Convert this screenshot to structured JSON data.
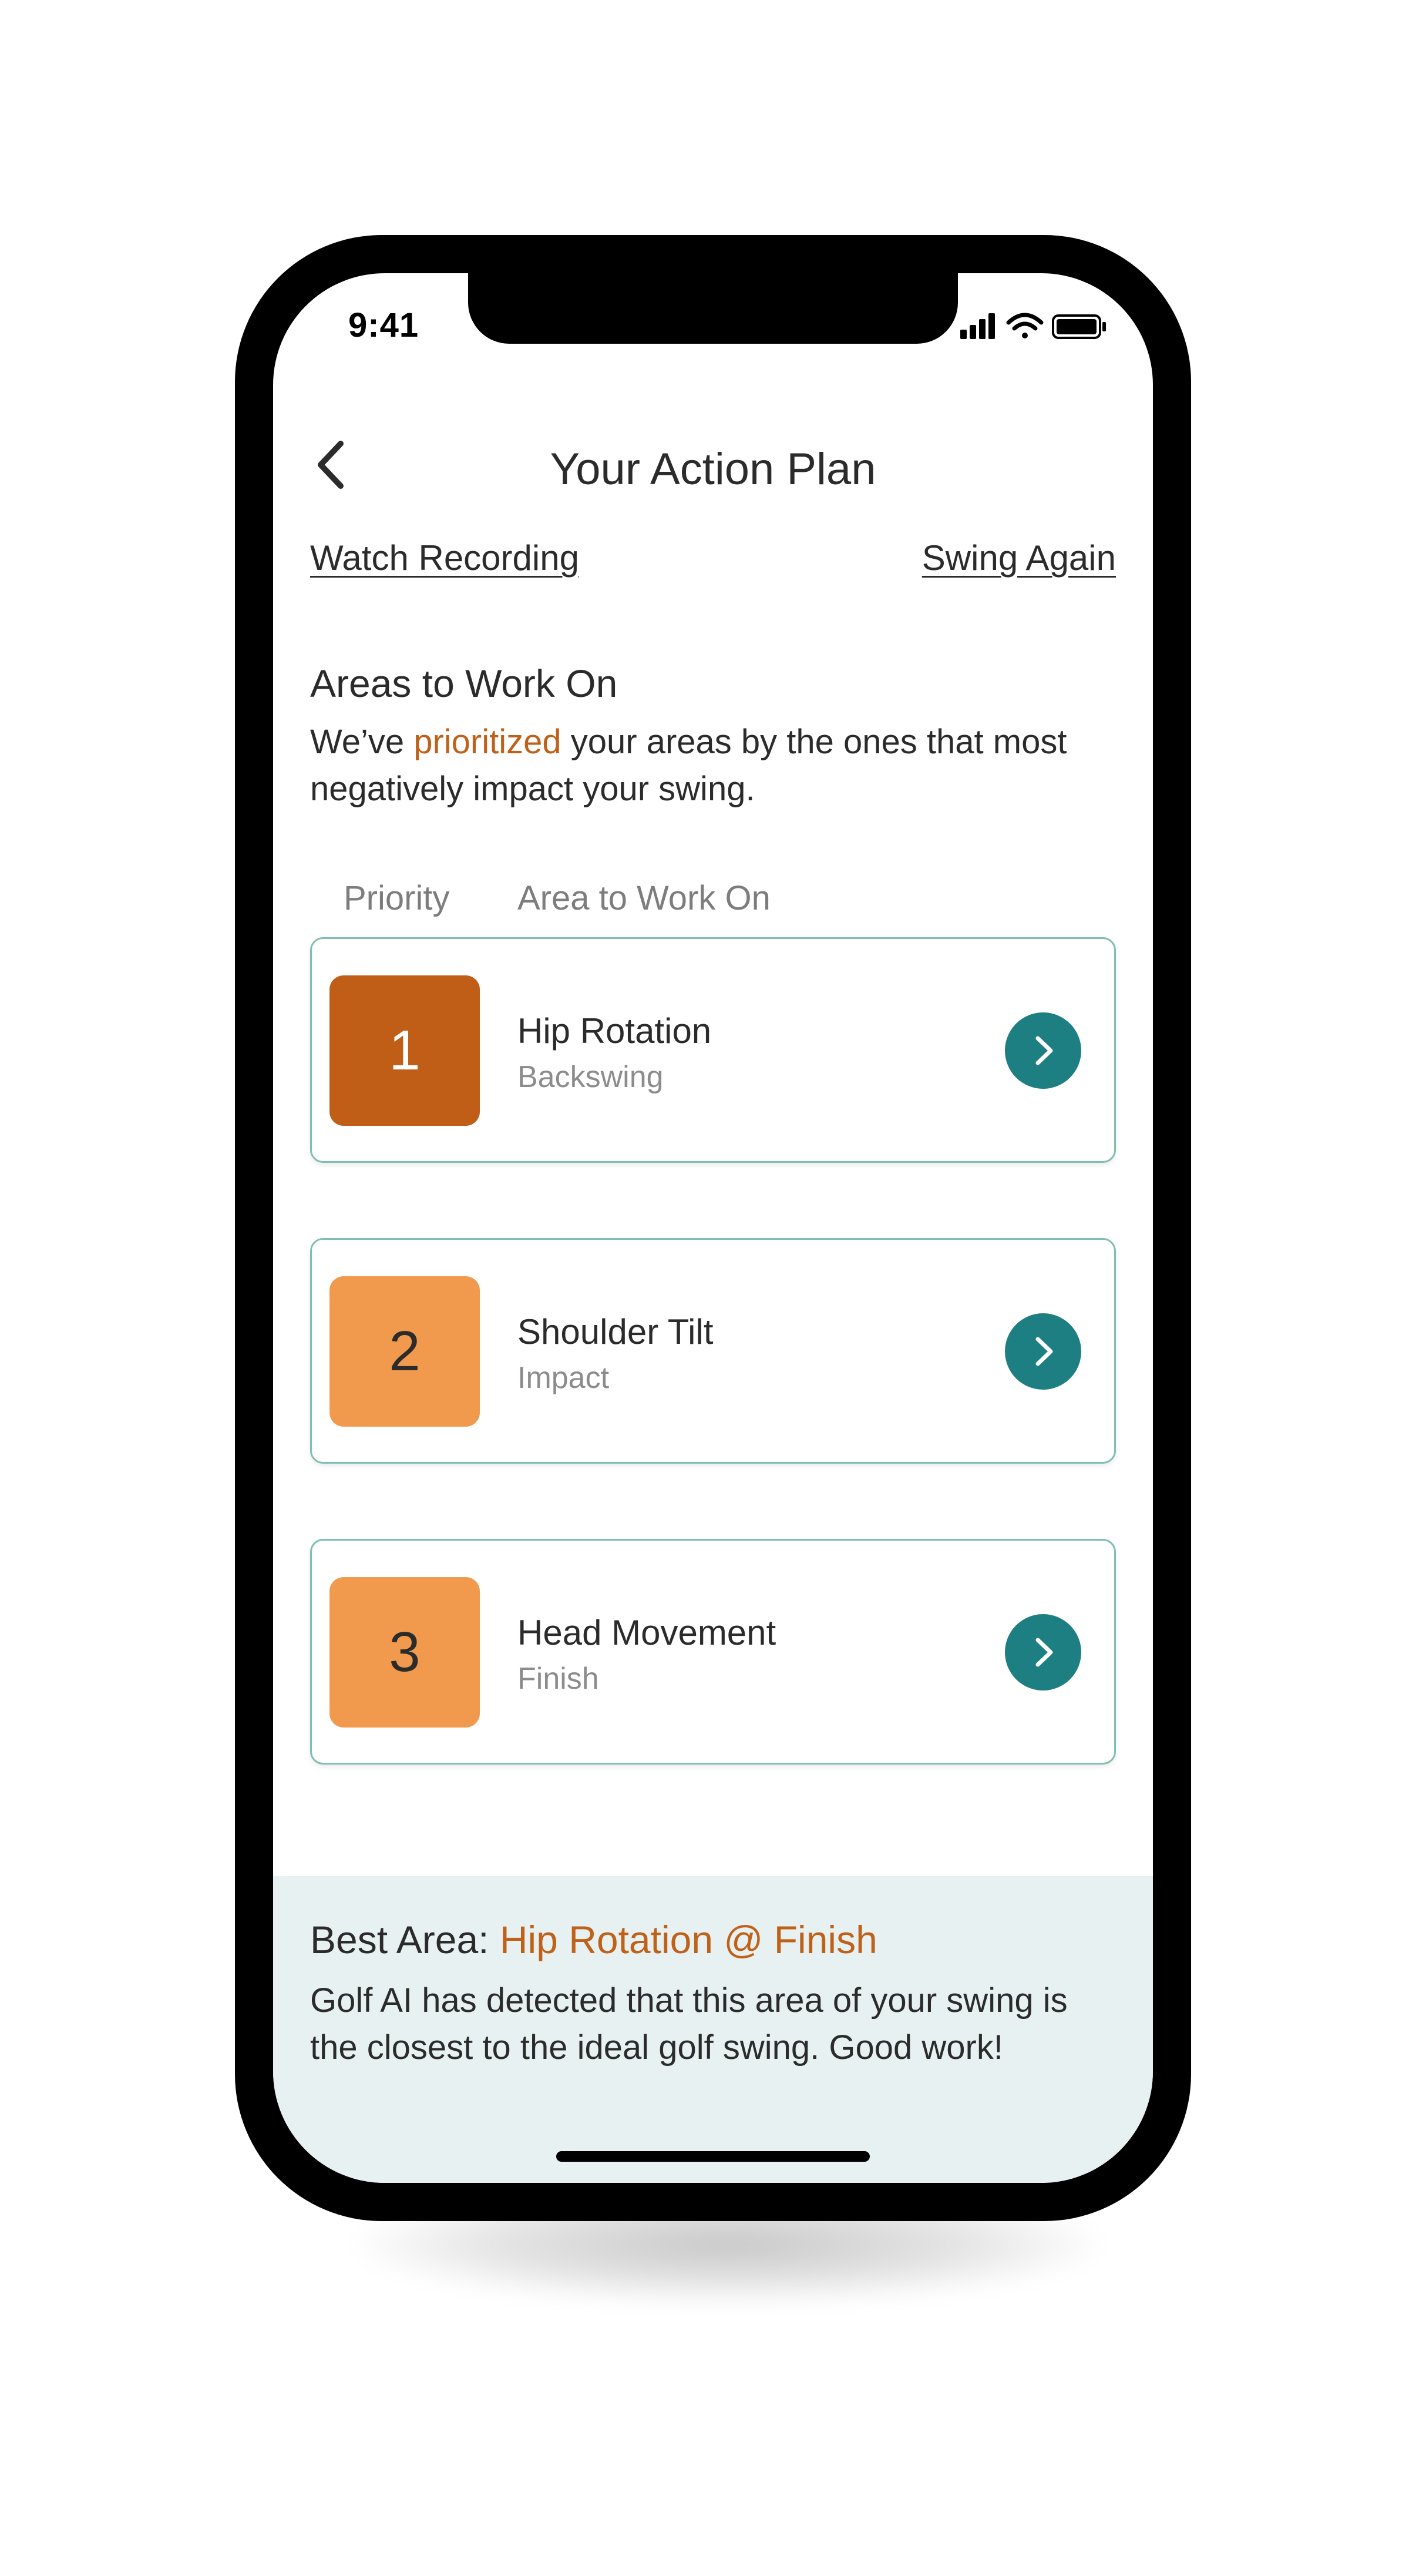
{
  "status_bar": {
    "time": "9:41",
    "icons": [
      "cellular-signal-icon",
      "wifi-icon",
      "battery-icon"
    ]
  },
  "header": {
    "back_icon": "chevron-left-icon",
    "title": "Your Action Plan"
  },
  "links": {
    "watch_recording": "Watch Recording",
    "swing_again": "Swing Again"
  },
  "areas_section": {
    "heading": "Areas to Work On",
    "desc_before": "We’ve ",
    "desc_highlight": "prioritized",
    "desc_after": " your areas by the ones that most negatively impact your swing.",
    "columns": {
      "priority": "Priority",
      "area": "Area to Work On"
    },
    "items": [
      {
        "priority": "1",
        "title": "Hip Rotation",
        "phase": "Backswing"
      },
      {
        "priority": "2",
        "title": "Shoulder Tilt",
        "phase": "Impact"
      },
      {
        "priority": "3",
        "title": "Head Movement",
        "phase": "Finish"
      }
    ]
  },
  "best_area": {
    "label": "Best Area: ",
    "value": "Hip Rotation @ Finish",
    "description": "Golf AI has detected that this area of your swing is the closest to the ideal golf swing. Good work!"
  },
  "colors": {
    "accent_orange": "#c0611a",
    "priority_high": "#c05e18",
    "priority_mid": "#f19a4d",
    "teal_button": "#1e7f82",
    "card_border": "#7fbfb1",
    "best_panel_bg": "#e7f1f1"
  }
}
